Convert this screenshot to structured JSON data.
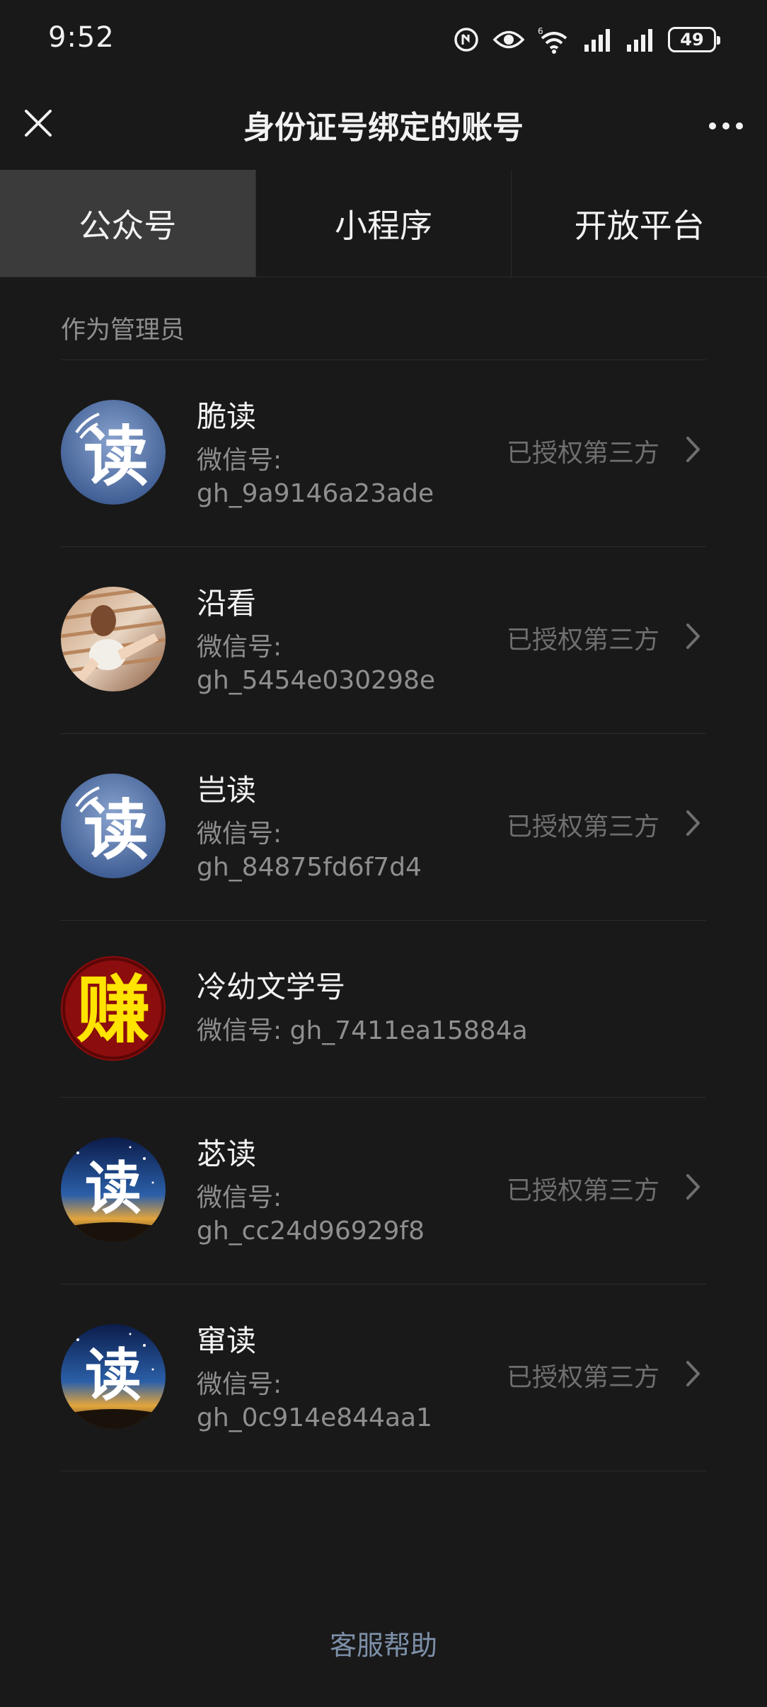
{
  "status_bar": {
    "time": "9:52",
    "battery": "49"
  },
  "nav": {
    "title": "身份证号绑定的账号",
    "close_icon": "close-icon",
    "more_icon": "more-horizontal-icon"
  },
  "tabs": [
    {
      "label": "公众号",
      "active": true
    },
    {
      "label": "小程序",
      "active": false
    },
    {
      "label": "开放平台",
      "active": false
    }
  ],
  "section": {
    "label": "作为管理员"
  },
  "accounts": [
    {
      "name": "脆读",
      "wxid_label": "微信号:",
      "wxid": "gh_9a9146a23ade",
      "status": "已授权第三方",
      "avatar_glyph": "读"
    },
    {
      "name": "沿看",
      "wxid_label": "微信号:",
      "wxid": "gh_5454e030298e",
      "status": "已授权第三方"
    },
    {
      "name": "岂读",
      "wxid_label": "微信号:",
      "wxid": "gh_84875fd6f7d4",
      "status": "已授权第三方",
      "avatar_glyph": "读"
    },
    {
      "name": "冷幼文学号",
      "wxid_label": "微信号:",
      "wxid": "gh_7411ea15884a",
      "status": "",
      "avatar_glyph": "赚"
    },
    {
      "name": "苾读",
      "wxid_label": "微信号:",
      "wxid": "gh_cc24d96929f8",
      "status": "已授权第三方",
      "avatar_glyph": "读"
    },
    {
      "name": "窜读",
      "wxid_label": "微信号:",
      "wxid": "gh_0c914e844aa1",
      "status": "已授权第三方",
      "avatar_glyph": "读"
    }
  ],
  "footer": {
    "help_label": "客服帮助"
  },
  "colors": {
    "background": "#191919",
    "active_tab": "#3b3b3b",
    "link": "#7d90a9",
    "muted": "#8f8f8f"
  }
}
